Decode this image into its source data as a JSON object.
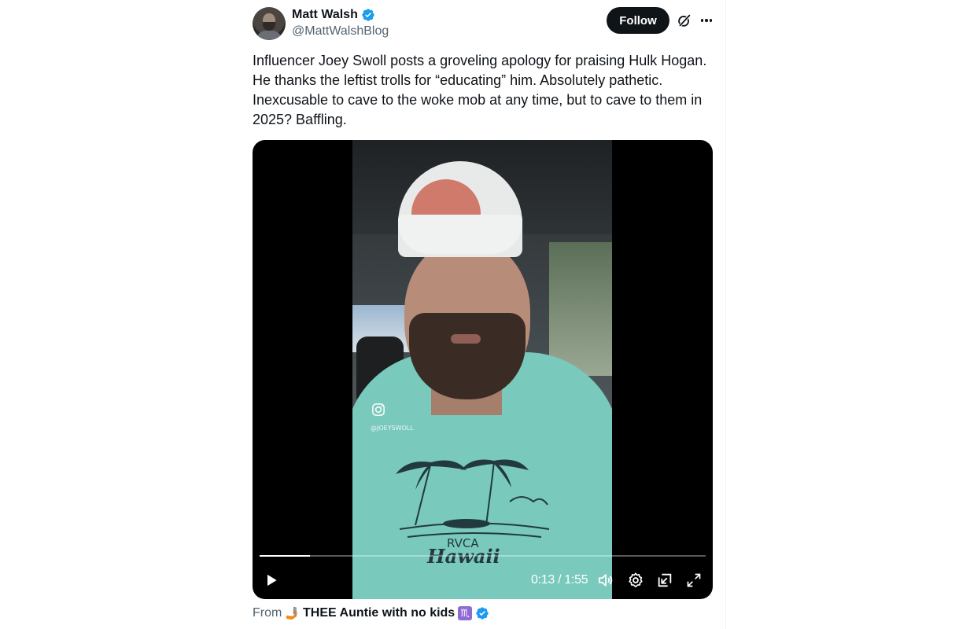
{
  "post": {
    "author": {
      "display_name": "Matt Walsh",
      "handle": "@MattWalshBlog",
      "verified": true
    },
    "follow_label": "Follow",
    "text_lines": [
      "Influencer Joey Swoll posts a groveling apology for praising Hulk Hogan.",
      "He thanks the leftist trolls for “educating” him. Absolutely pathetic.",
      "Inexcusable to cave to the woke mob at any time, but to cave to them in",
      "2025? Baffling."
    ],
    "video": {
      "watermark_handle": "@JOEYSWOLL",
      "shirt_brand": "RVCA",
      "shirt_text": "Hawaii",
      "current_time": "0:13",
      "time_separator": "/",
      "duration": "1:55",
      "progress_fraction": 0.113,
      "controls": [
        "play-icon",
        "volume-icon",
        "settings-icon",
        "dock-icon",
        "fullscreen-icon"
      ]
    },
    "source": {
      "from_label": "From",
      "emoji": "🤳🏽",
      "account_name": "THEE Auntie with no kids",
      "zodiac": "♏",
      "verified": true
    }
  },
  "colors": {
    "accent_blue": "#1d9bf0",
    "text_primary": "#0f1419",
    "text_secondary": "#536471",
    "button_dark": "#0f1419"
  }
}
